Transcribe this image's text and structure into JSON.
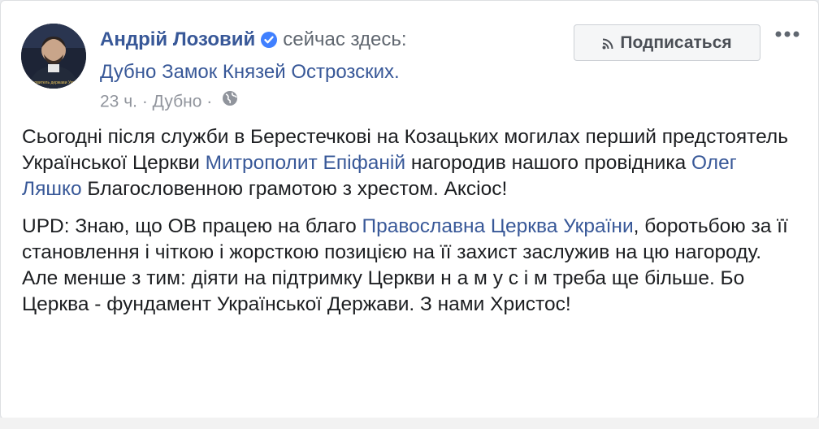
{
  "post": {
    "author": "Андрій Лозовий",
    "action": "сейчас здесь:",
    "place": "Дубно Замок Князей Острозских.",
    "time": "23 ч.",
    "location": "Дубно",
    "separator": "·",
    "follow_label": "Подписаться",
    "more_label": "•••",
    "avatar_caption": "Вдохновитель держави Українок",
    "p1": [
      "Сьогодні після служби в Берестечкові на Козацьких могилах перший предстоятель Української Церкви ",
      "Митрополит Епіфаній",
      " нагородив нашого провідника ",
      "Олег Ляшко",
      " Благословенною грамотою з хрестом. Аксіос!"
    ],
    "p2": [
      "UPD: Знаю, що ОВ працею на благо ",
      "Православна Церква України",
      ", боротьбою за її становлення і чіткою і жорсткою позицією на її захист заслужив на цю нагороду. Але менше з тим: діяти на підтримку Церкви н а м у с і м треба ще більше. Бо Церква - фундамент Української Держави. З нами Христос!"
    ]
  },
  "colors": {
    "link": "#385898",
    "meta": "#90949c",
    "text": "#1c1e21",
    "verified": "#4080ff"
  },
  "icons": {
    "verified": "verified-badge-icon",
    "globe": "globe-icon",
    "follow": "rss-icon",
    "more": "more-dots-icon"
  }
}
